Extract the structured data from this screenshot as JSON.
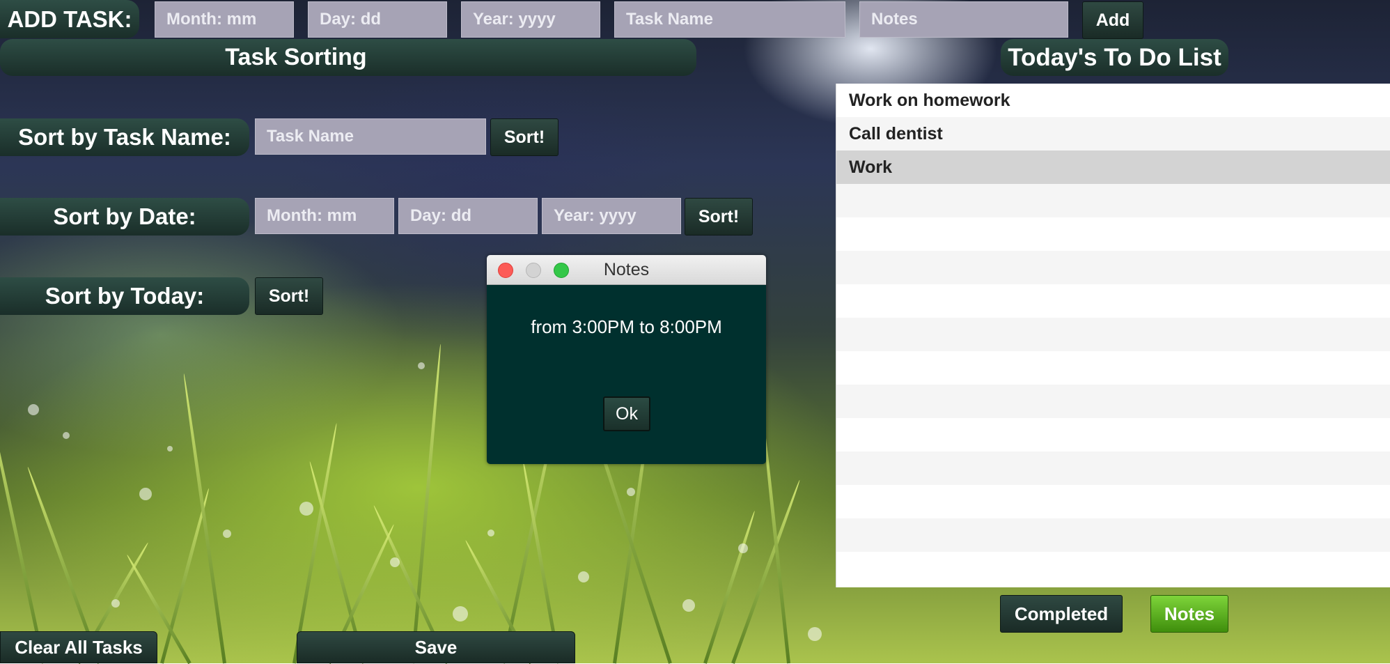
{
  "add_task": {
    "label": "ADD TASK:",
    "month_placeholder": "Month: mm",
    "day_placeholder": "Day: dd",
    "year_placeholder": "Year: yyyy",
    "task_name_placeholder": "Task Name",
    "notes_placeholder": "Notes",
    "add_button": "Add"
  },
  "sorting": {
    "header": "Task Sorting",
    "by_name_label": "Sort by Task Name:",
    "by_name_placeholder": "Task Name",
    "by_date_label": "Sort by Date:",
    "month_placeholder": "Month: mm",
    "day_placeholder": "Day: dd",
    "year_placeholder": "Year: yyyy",
    "by_today_label": "Sort by Today:",
    "sort_button": "Sort!"
  },
  "todo": {
    "header": "Today's To Do List",
    "items": [
      "Work on homework",
      "Call dentist",
      "Work"
    ],
    "selected_index": 2
  },
  "footer": {
    "completed_button": "Completed",
    "notes_button": "Notes",
    "clear_button": "Clear All Tasks",
    "save_button": "Save"
  },
  "dialog": {
    "title": "Notes",
    "message": "from 3:00PM to 8:00PM",
    "ok_button": "Ok"
  },
  "colors": {
    "accent_dark_green": "#1f3a33",
    "dialog_bg": "#00302e",
    "notes_button_green": "#5fb61a",
    "input_bg": "#a6a3b5"
  }
}
